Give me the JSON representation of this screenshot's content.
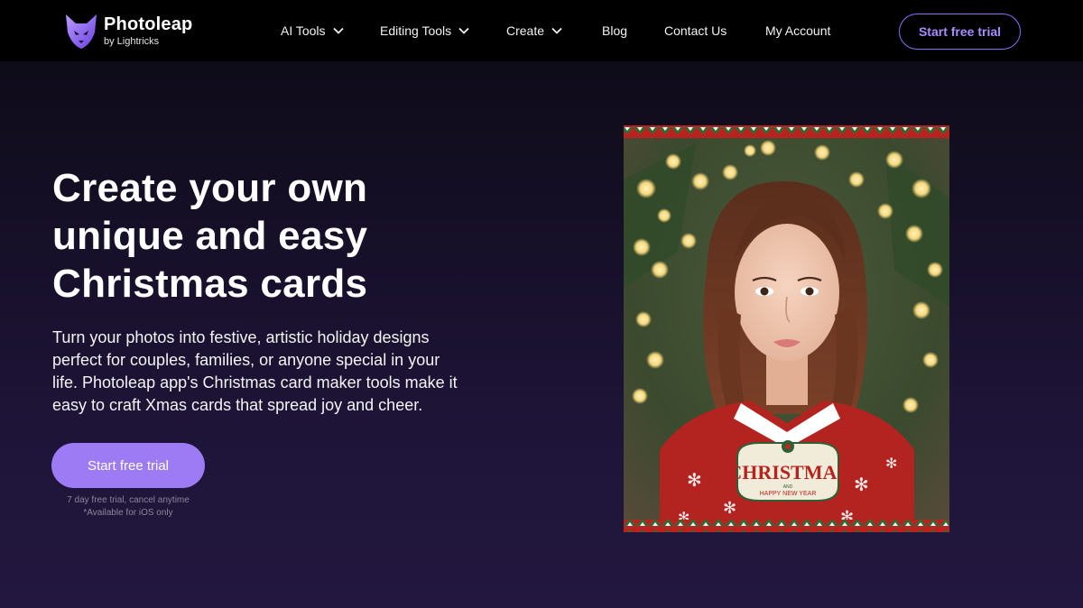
{
  "brand": {
    "name": "Photoleap",
    "subtitle": "by Lightricks",
    "logo_icon": "fox-logo-icon",
    "color": "#7b55e8"
  },
  "nav": {
    "items": [
      {
        "label": "AI Tools",
        "has_dropdown": true
      },
      {
        "label": "Editing Tools",
        "has_dropdown": true
      },
      {
        "label": "Create",
        "has_dropdown": true
      },
      {
        "label": "Blog",
        "has_dropdown": false
      },
      {
        "label": "Contact Us",
        "has_dropdown": false
      },
      {
        "label": "My Account",
        "has_dropdown": false
      }
    ],
    "cta_label": "Start free trial",
    "cta_color": "#8e6ef7"
  },
  "hero": {
    "title_lines": [
      "Create your own",
      "unique and easy",
      "Christmas cards"
    ],
    "description_lines": [
      "Turn your photos into festive, artistic holiday designs",
      "perfect for couples, families, or anyone special in your",
      "life. Photoleap app's Christmas card maker tools make it",
      "easy to craft Xmas cards that spread joy and cheer."
    ],
    "cta_label": "Start free trial",
    "cta_color": "#9d7bf5",
    "notes": [
      "7 day free trial, cancel anytime",
      "*Available for iOS only"
    ]
  },
  "card": {
    "badge_title": "CHRISTMAS",
    "badge_and": "AND",
    "badge_subtitle": "HAPPY NEW YEAR"
  }
}
